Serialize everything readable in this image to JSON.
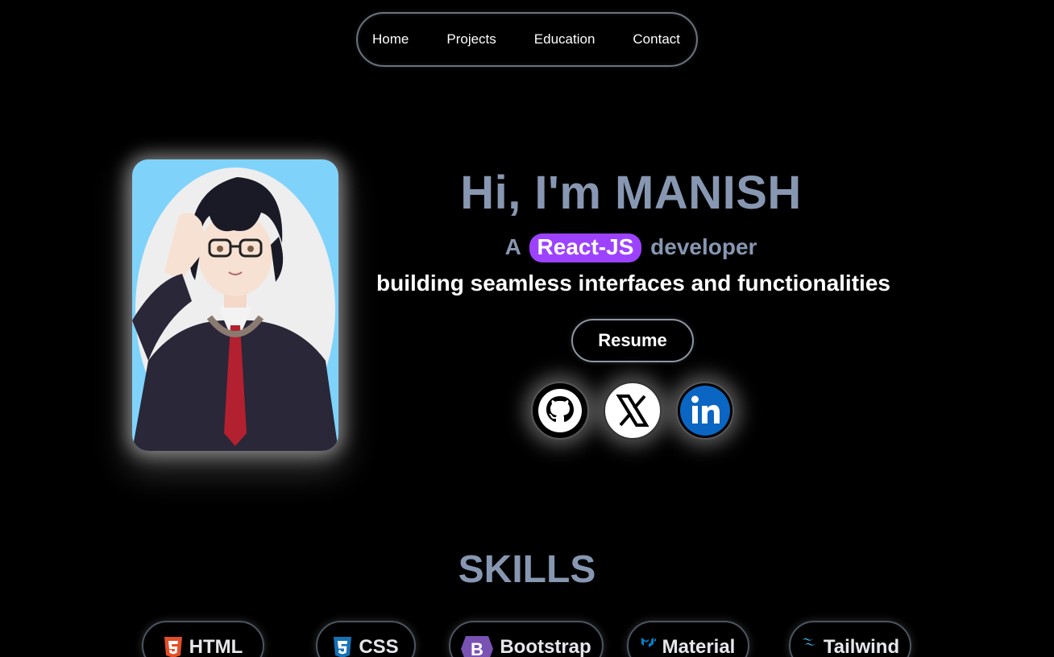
{
  "nav": {
    "items": [
      {
        "label": "Home"
      },
      {
        "label": "Projects"
      },
      {
        "label": "Education"
      },
      {
        "label": "Contact"
      }
    ]
  },
  "hero": {
    "title": "Hi, I'm MANISH",
    "role_prefix": "A",
    "role_highlight": "React-JS",
    "role_suffix": "developer",
    "tagline": "building seamless interfaces and functionalities",
    "resume_label": "Resume"
  },
  "social": [
    {
      "icon": "github-icon"
    },
    {
      "icon": "x-icon"
    },
    {
      "icon": "linkedin-icon"
    }
  ],
  "skills": {
    "title": "SKILLS",
    "items": [
      {
        "label": "HTML",
        "icon": "html5-icon",
        "color": "#e34f26"
      },
      {
        "label": "CSS",
        "icon": "css3-icon",
        "color": "#1572b6"
      },
      {
        "label": "Bootstrap",
        "icon": "bootstrap-icon",
        "color": "#7952b3"
      },
      {
        "label": "Material",
        "icon": "material-ui-icon",
        "color": "#0081cb"
      },
      {
        "label": "Tailwind",
        "icon": "tailwind-icon",
        "color": "#38bdf8"
      }
    ]
  },
  "colors": {
    "background": "#000000",
    "heading": "#8797b2",
    "highlight": "#9d42ff",
    "avatar_bg": "#7fd3fb"
  }
}
